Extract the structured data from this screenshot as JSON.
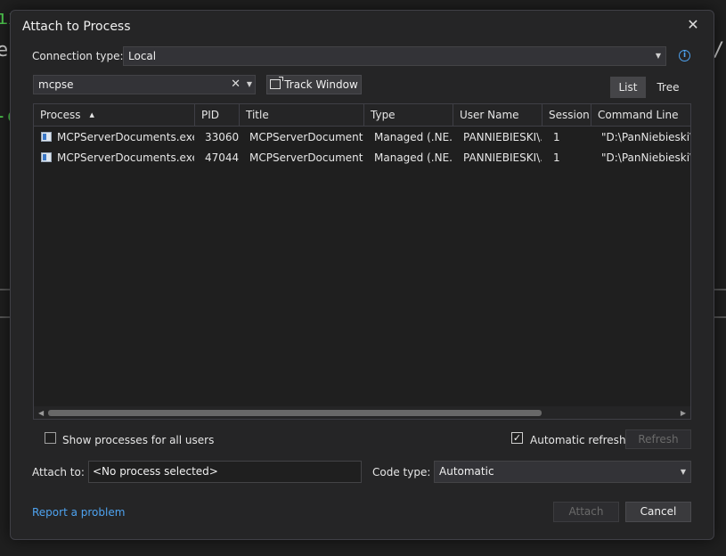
{
  "dialog": {
    "title": "Attach to Process",
    "close_icon": "close-icon"
  },
  "connection": {
    "label": "Connection type:",
    "value": "Local"
  },
  "filter": {
    "value": "mcpse",
    "clear_glyph": "✕",
    "track_window_label": "Track Window"
  },
  "view_toggle": {
    "list_label": "List",
    "tree_label": "Tree",
    "active": "List"
  },
  "grid": {
    "columns": [
      "Process",
      "PID",
      "Title",
      "Type",
      "User Name",
      "Session",
      "Command Line"
    ],
    "sort_column": "Process",
    "rows": [
      {
        "process": "MCPServerDocuments.exe",
        "pid": "33060",
        "title": "MCPServerDocuments",
        "type": "Managed (.NE...",
        "user": "PANNIEBIESKI\\...",
        "session": "1",
        "cmd": "\"D:\\PanNiebieski\\W"
      },
      {
        "process": "MCPServerDocuments.exe",
        "pid": "47044",
        "title": "MCPServerDocuments",
        "type": "Managed (.NE...",
        "user": "PANNIEBIESKI\\...",
        "session": "1",
        "cmd": "\"D:\\PanNiebieski\\W"
      }
    ]
  },
  "options": {
    "show_all_users_label": "Show processes for all users",
    "show_all_users": false,
    "auto_refresh_label": "Automatic refresh",
    "auto_refresh": true,
    "refresh_label": "Refresh"
  },
  "attach_to": {
    "label": "Attach to:",
    "value": "<No process selected>"
  },
  "code_type": {
    "label": "Code type:",
    "value": "Automatic"
  },
  "footer": {
    "report_link": "Report a problem",
    "attach_label": "Attach",
    "cancel_label": "Cancel"
  },
  "background": {
    "fragment_1": "ıx",
    "fragment_2": "e",
    "fragment_3": "/",
    "fragment_4": "-c"
  },
  "colors": {
    "accent_link": "#4ea3f0",
    "dialog_bg": "#252526",
    "grid_bg": "#1f1f1f"
  }
}
